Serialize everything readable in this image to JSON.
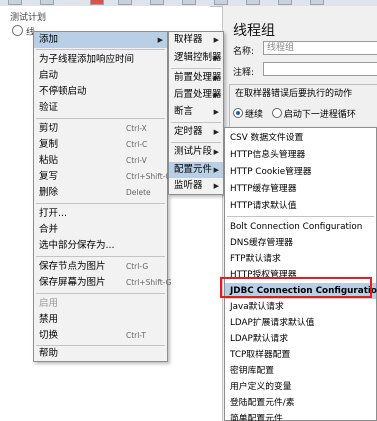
{
  "tree": {
    "items": [
      "测试计划",
      "线"
    ]
  },
  "panel": {
    "title": "线程组",
    "name_label": "名称:",
    "name_value": "线程组",
    "comment_label": "注释:",
    "group_title": "在取样器错误后要执行的动作",
    "radio_continue": "继续",
    "radio_next": "启动下一进程循环"
  },
  "menu_main": {
    "items": [
      {
        "label": "添加",
        "shortcut": "",
        "submenu": true
      },
      {
        "label": "为子线程添加响应时间",
        "shortcut": ""
      },
      {
        "label": "启动",
        "shortcut": ""
      },
      {
        "label": "不停顿启动",
        "shortcut": ""
      },
      {
        "label": "验证",
        "shortcut": ""
      },
      {
        "label": "剪切",
        "shortcut": "Ctrl-X"
      },
      {
        "label": "复制",
        "shortcut": "Ctrl-C"
      },
      {
        "label": "粘贴",
        "shortcut": "Ctrl-V"
      },
      {
        "label": "复写",
        "shortcut": "Ctrl+Shift-C"
      },
      {
        "label": "删除",
        "shortcut": "Delete"
      },
      {
        "label": "打开...",
        "shortcut": ""
      },
      {
        "label": "合并",
        "shortcut": ""
      },
      {
        "label": "选中部分保存为...",
        "shortcut": ""
      },
      {
        "label": "保存节点为图片",
        "shortcut": "Ctrl-G"
      },
      {
        "label": "保存屏幕为图片",
        "shortcut": "Ctrl+Shift-G"
      },
      {
        "label": "启用",
        "shortcut": ""
      },
      {
        "label": "禁用",
        "shortcut": ""
      },
      {
        "label": "切换",
        "shortcut": "Ctrl-T"
      },
      {
        "label": "帮助",
        "shortcut": ""
      }
    ]
  },
  "menu_add": {
    "items": [
      "取样器",
      "逻辑控制器",
      "前置处理器",
      "后置处理器",
      "断言",
      "定时器",
      "测试片段",
      "配置元件",
      "监听器"
    ]
  },
  "menu_config": {
    "items": [
      "CSV 数据文件设置",
      "HTTP信息头管理器",
      "HTTP Cookie管理器",
      "HTTP缓存管理器",
      "HTTP请求默认值",
      "Bolt Connection Configuration",
      "DNS缓存管理器",
      "FTP默认请求",
      "HTTP授权管理器",
      "JDBC Connection Configuration",
      "Java默认请求",
      "LDAP扩展请求默认值",
      "LDAP默认请求",
      "TCP取样器配置",
      "密钥库配置",
      "用户定义的变量",
      "登陆配置元件/素",
      "简单配置元件"
    ]
  },
  "colors": {
    "menu_highlight": "#b8cfe5",
    "callout_border": "#e02020",
    "radio_accent": "#2f5fa0"
  }
}
